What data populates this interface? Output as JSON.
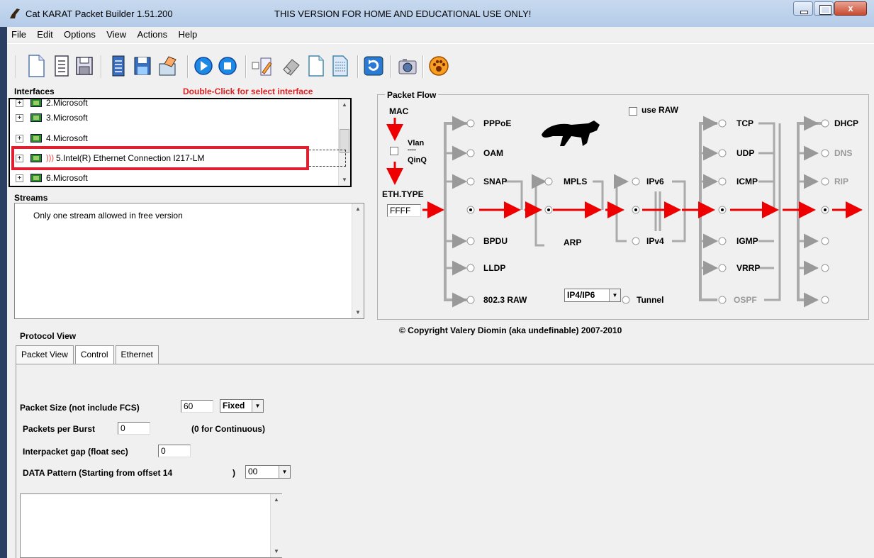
{
  "window": {
    "title": "Cat KARAT Packet Builder 1.51.200",
    "notice": "THIS VERSION FOR HOME AND EDUCATIONAL USE ONLY!",
    "close_label": "x"
  },
  "menu": [
    "File",
    "Edit",
    "Options",
    "View",
    "Actions",
    "Help"
  ],
  "interfaces": {
    "heading": "Interfaces",
    "hint": "Double-Click for select interface",
    "items": [
      "2.Microsoft",
      "3.Microsoft",
      "4.Microsoft",
      "5.Intel(R) Ethernet Connection I217-LM",
      "6.Microsoft"
    ]
  },
  "streams": {
    "heading": "Streams",
    "message": "Only one stream allowed in free version"
  },
  "packet_flow": {
    "heading": "Packet Flow",
    "mac": "MAC",
    "vlan": "Vlan",
    "vlan_sep": "----",
    "qinq": "QinQ",
    "eth_type": "ETH.TYPE",
    "eth_type_value": "FFFF",
    "use_raw": "use RAW",
    "l2": [
      "PPPoE",
      "OAM",
      "SNAP",
      "BPDU",
      "LLDP",
      "802.3 RAW"
    ],
    "mpls": "MPLS",
    "arp": "ARP",
    "ipv6": "IPv6",
    "ipv4": "IPv4",
    "ip_select": "IP4/IP6",
    "tunnel": "Tunnel",
    "l4": [
      "TCP",
      "UDP",
      "ICMP",
      "IGMP",
      "VRRP",
      "OSPF"
    ],
    "l5": [
      "DHCP",
      "DNS",
      "RIP"
    ]
  },
  "copyright": "© Copyright Valery Diomin (aka undefinable) 2007-2010",
  "protocol_view": {
    "heading": "Protocol View",
    "tabs": [
      "Packet View",
      "Control",
      "Ethernet"
    ]
  },
  "control": {
    "packet_size_label": "Packet Size (not include FCS)",
    "packet_size_value": "60",
    "size_mode": "Fixed",
    "burst_label": "Packets per Burst",
    "burst_value": "0",
    "burst_hint": "(0 for Continuous)",
    "gap_label": "Interpacket gap (float sec)",
    "gap_value": "0",
    "pattern_label": "DATA Pattern (Starting from offset  14",
    "pattern_close": ")",
    "pattern_value": "00"
  }
}
